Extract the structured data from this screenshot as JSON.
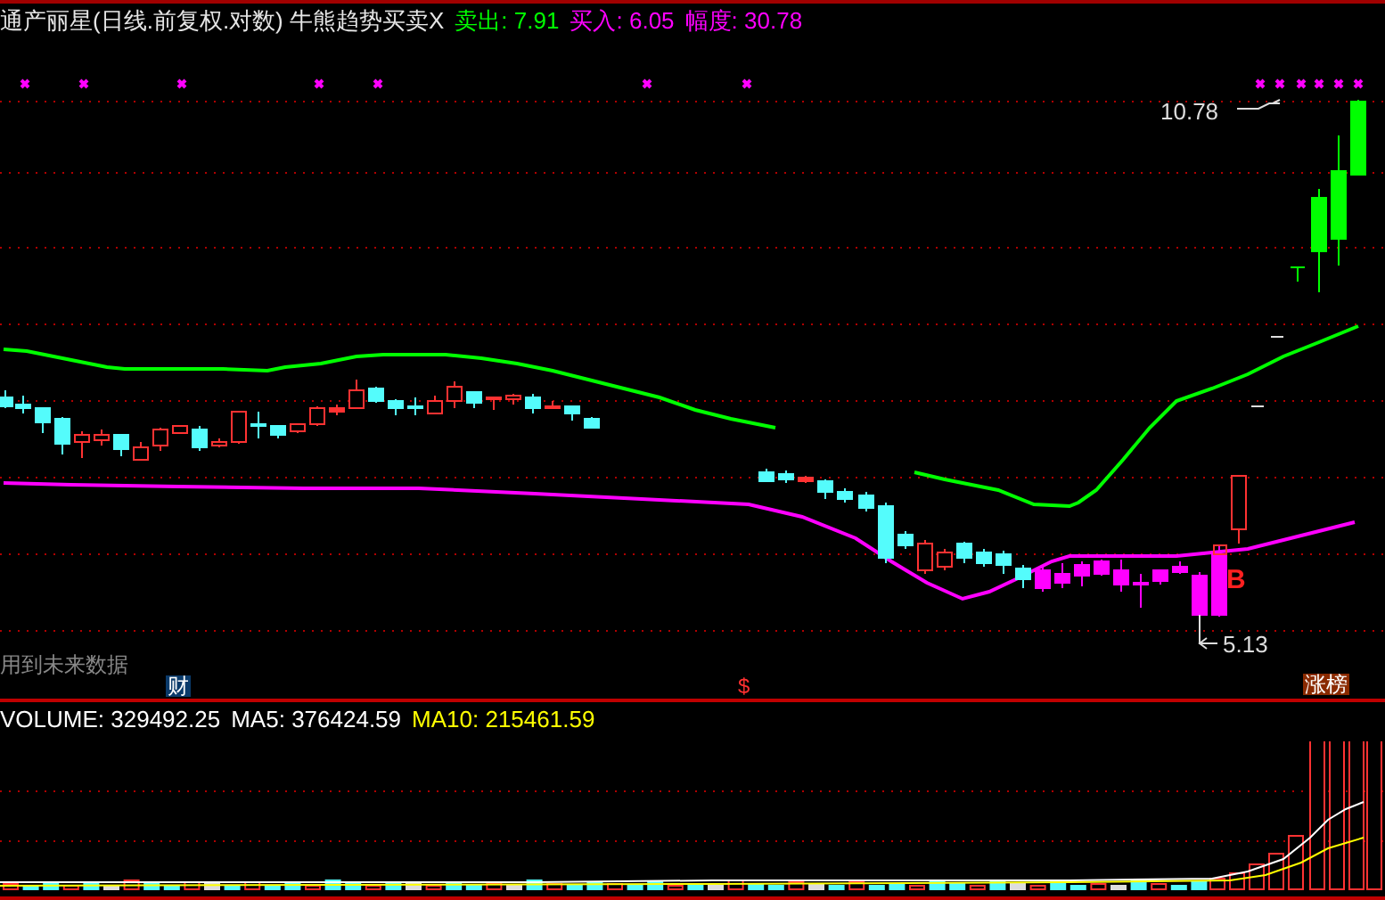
{
  "header": {
    "title": "通产丽星(日线.前复权.对数) 牛熊趋势买卖X",
    "readings": [
      {
        "label": "卖出:",
        "value": "7.91",
        "color": "#00ff00"
      },
      {
        "label": "买入:",
        "value": "6.05",
        "color": "#ff00ff"
      },
      {
        "label": "幅度:",
        "value": "30.78",
        "color": "#ff00ff"
      }
    ]
  },
  "price_panel": {
    "high_label": "10.78",
    "low_label": "5.13",
    "signal": "B",
    "warning": "用到未来数据",
    "finance_badge": "财",
    "dollar_mark": "$",
    "rank_badge": "涨榜"
  },
  "volume_panel": {
    "readings": [
      {
        "label": "VOLUME:",
        "value": "329492.25",
        "color": "#ffffff"
      },
      {
        "label": "MA5:",
        "value": "376424.59",
        "color": "#ffffff"
      },
      {
        "label": "MA10:",
        "value": "215461.59",
        "color": "#ffff00"
      }
    ]
  }
}
